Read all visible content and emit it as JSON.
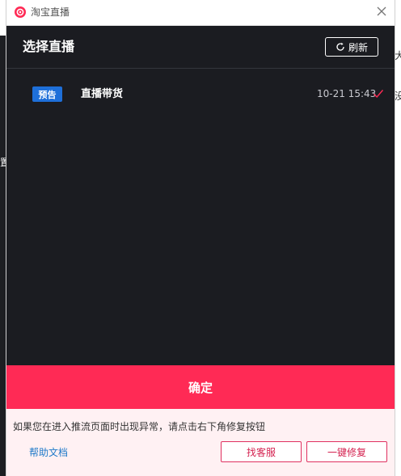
{
  "window": {
    "title": "淘宝直播"
  },
  "header": {
    "title": "选择直播",
    "refresh_label": "刷新"
  },
  "live_list": [
    {
      "badge": "预告",
      "title": "直播带货",
      "time": "10-21 15:43",
      "selected": true
    }
  ],
  "actions": {
    "confirm_label": "确定"
  },
  "footer": {
    "note": "如果您在进入推流页面时出现异常，请点击右下角修复按钮",
    "help_label": "帮助文档",
    "service_label": "找客服",
    "repair_label": "一键修复"
  },
  "background": {
    "glyphs": [
      "大",
      "没",
      "置"
    ]
  },
  "colors": {
    "accent": "#ff2a55",
    "badge": "#1e6fd9",
    "panel": "#1b1c21",
    "footer_bg": "#fff1f3",
    "link": "#1f7ac9"
  },
  "icons": [
    "taobao-live-icon",
    "close-icon",
    "refresh-icon",
    "check-icon"
  ]
}
